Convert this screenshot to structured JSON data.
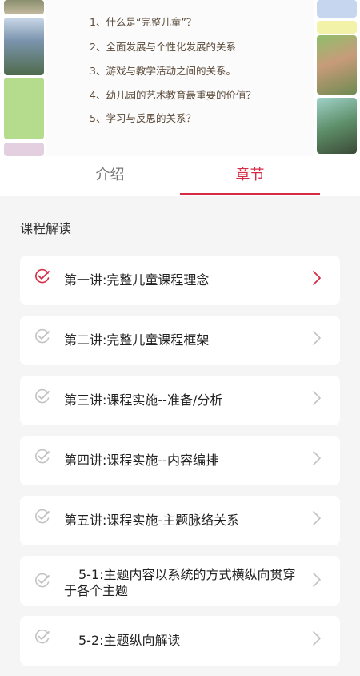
{
  "video": {
    "items": [
      "1、什么是“完整儿童”？",
      "2、全面发展与个性化发展的关系",
      "3、游戏与教学活动之间的关系。",
      "4、幼儿园的艺术教育最重要的价值？",
      "5、学习与反思的关系？"
    ]
  },
  "tabs": {
    "intro": "介绍",
    "chapters": "章节",
    "active": "chapters"
  },
  "section": {
    "title": "课程解读"
  },
  "chapters": [
    {
      "label": "第一讲:完整儿童课程理念",
      "active": true
    },
    {
      "label": "第二讲:完整儿童课程框架",
      "active": false
    },
    {
      "label": "第三讲:课程实施--准备/分析",
      "active": false
    },
    {
      "label": "第四讲:课程实施--内容编排",
      "active": false
    },
    {
      "label": "第五讲:课程实施-主题脉络关系",
      "active": false
    },
    {
      "label": "5-1:主题内容以系统的方式横纵向贯穿于各个主题",
      "active": false
    },
    {
      "label": "5-2:主题纵向解读",
      "active": false
    }
  ],
  "colors": {
    "accent": "#d52c45",
    "inactive_icon": "#c2c2c2",
    "background": "#f5f5f5"
  },
  "icons": {
    "check": "check-circle-icon",
    "chevron": "chevron-right-icon"
  }
}
